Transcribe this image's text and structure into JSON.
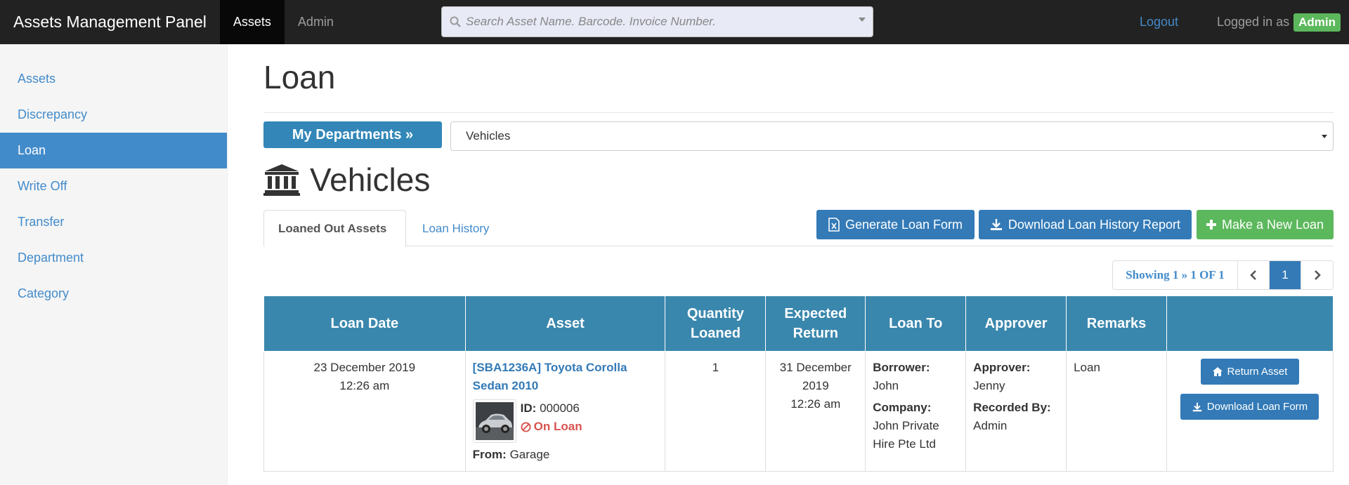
{
  "navbar": {
    "brand": "Assets Management Panel",
    "tabs": [
      {
        "label": "Assets",
        "active": true
      },
      {
        "label": "Admin",
        "active": false
      }
    ],
    "search_placeholder": "Search Asset Name. Barcode. Invoice Number.",
    "logout_label": "Logout",
    "logged_in_label": "Logged in as",
    "user_badge": "Admin"
  },
  "sidebar": {
    "items": [
      {
        "label": "Assets"
      },
      {
        "label": "Discrepancy"
      },
      {
        "label": "Loan",
        "active": true
      },
      {
        "label": "Write Off"
      },
      {
        "label": "Transfer"
      },
      {
        "label": "Department"
      },
      {
        "label": "Category"
      }
    ]
  },
  "main": {
    "title": "Loan",
    "dept_button": "My Departments »",
    "dept_selected": "Vehicles",
    "dept_title": "Vehicles",
    "tabs": [
      {
        "label": "Loaned Out Assets",
        "active": true
      },
      {
        "label": "Loan History",
        "active": false
      }
    ],
    "actions": {
      "generate": "Generate Loan Form",
      "download_history": "Download Loan History Report",
      "new_loan": "Make a New Loan"
    },
    "pager": {
      "info": "Showing 1 » 1 OF 1",
      "current": "1"
    }
  },
  "table": {
    "headers": [
      "Loan Date",
      "Asset",
      "Quantity Loaned",
      "Expected Return",
      "Loan To",
      "Approver",
      "Remarks",
      ""
    ],
    "row": {
      "loan_date_1": "23 December 2019",
      "loan_date_2": "12:26 am",
      "asset_name": "[SBA1236A] Toyota Corolla Sedan 2010",
      "id_label": "ID:",
      "id_value": "000006",
      "status": "On Loan",
      "from_label": "From:",
      "from_value": "Garage",
      "quantity": "1",
      "return_1": "31 December",
      "return_2": "2019",
      "return_3": "12:26 am",
      "borrower_label": "Borrower:",
      "borrower_value": "John",
      "company_label": "Company:",
      "company_value": "John Private Hire Pte Ltd",
      "approver_label": "Approver:",
      "approver_value": "Jenny",
      "recorded_label": "Recorded By:",
      "recorded_value": "Admin",
      "remarks": "Loan",
      "return_button": "Return Asset",
      "download_button": "Download Loan Form"
    }
  },
  "colors": {
    "navbar": "#222222",
    "accent": "#428bca",
    "table_header": "#3a87ad",
    "success": "#5cb85c",
    "danger": "#d9534f"
  }
}
